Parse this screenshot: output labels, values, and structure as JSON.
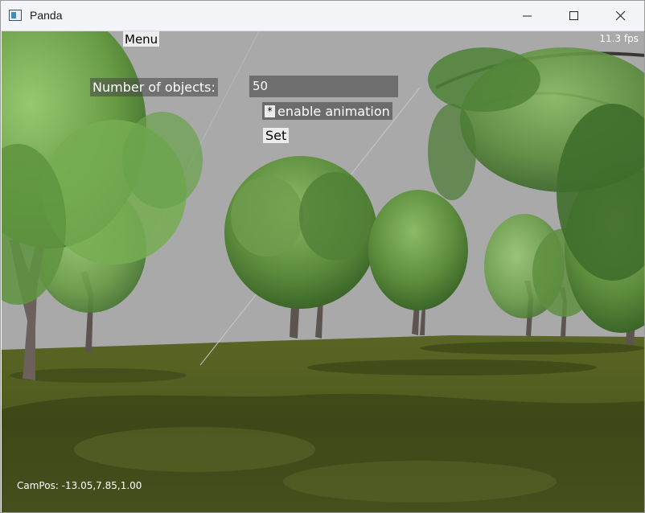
{
  "window": {
    "title": "Panda",
    "controls": [
      "minimize-icon",
      "maximize-icon",
      "close-icon"
    ]
  },
  "gui": {
    "menu_label": "Menu",
    "objects_label": "Number of objects:",
    "objects_value": "50",
    "animation_checkbox_mark": "*",
    "animation_label": "enable animation",
    "set_label": "Set",
    "fps": "11.3 fps",
    "campos": "CamPos: -13.05,7.85,1.00"
  },
  "colors": {
    "sky": "#a9a9a9",
    "grass": "#4a5a1e",
    "bark": "#5a4e4a",
    "foliage_light": "#7ab055",
    "foliage_dark": "#3e6a2a"
  }
}
